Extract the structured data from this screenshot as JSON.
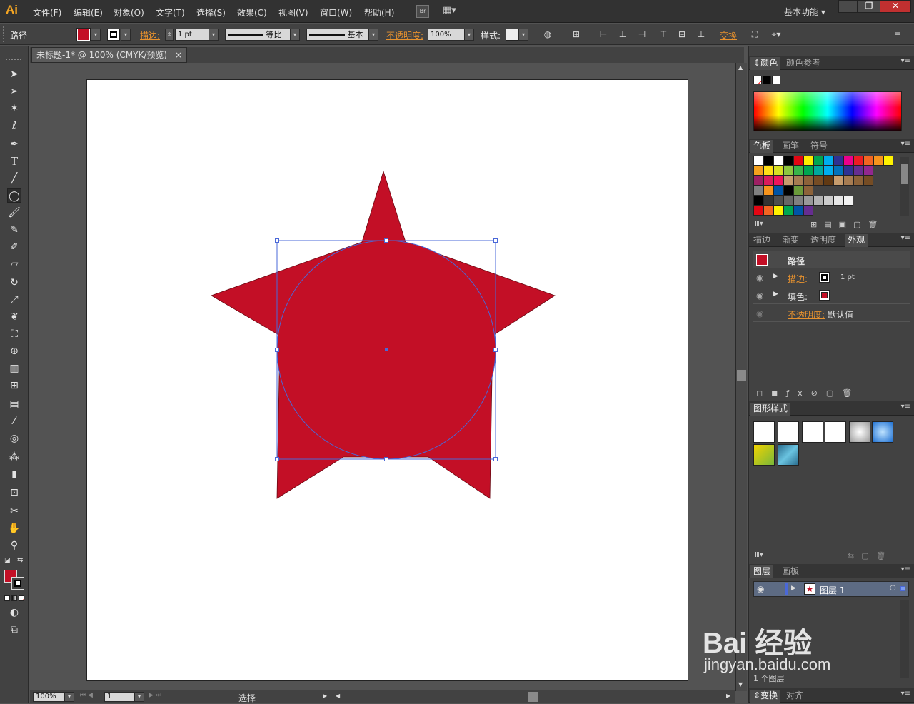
{
  "app": {
    "logo": "Ai",
    "workspace": "基本功能",
    "bridge": "Br"
  },
  "menu": [
    "文件(F)",
    "编辑(E)",
    "对象(O)",
    "文字(T)",
    "选择(S)",
    "效果(C)",
    "视图(V)",
    "窗口(W)",
    "帮助(H)"
  ],
  "control": {
    "object_type": "路径",
    "stroke_label": "描边:",
    "stroke_weight": "1 pt",
    "stroke_profile": "等比",
    "brush": "基本",
    "opacity_label": "不透明度:",
    "opacity": "100%",
    "style_label": "样式:",
    "transform": "变换"
  },
  "document": {
    "tab_title": "未标题-1* @ 100% (CMYK/预览)",
    "close": "×"
  },
  "status": {
    "zoom": "100%",
    "artboard": "1",
    "tool": "选择"
  },
  "panels": {
    "color": {
      "tabs": [
        "颜色",
        "颜色参考"
      ]
    },
    "swatches": {
      "tabs": [
        "色板",
        "画笔",
        "符号"
      ],
      "rows": [
        [
          "#ffffff",
          "#000000",
          "#ffffff",
          "#000000",
          "#e30613",
          "#ffed00",
          "#00a651",
          "#00aeef",
          "#2e3192",
          "#ec008c",
          "#ed1c24",
          "#f26522",
          "#f7941d",
          "#fff200"
        ],
        [
          "#f5a11c",
          "#ffde17",
          "#d7df23",
          "#8dc63f",
          "#39b54a",
          "#00a651",
          "#00a99d",
          "#00aeef",
          "#0072bc",
          "#2e3192",
          "#662d91",
          "#92278f"
        ],
        [
          "#9e1f63",
          "#d91b5c",
          "#ed145b",
          "#c69c6d",
          "#a67c52",
          "#8c6239",
          "#754c24",
          "#603913",
          "#c69c6d",
          "#a67c52",
          "#8c6239",
          "#754c24"
        ],
        [
          "#808080",
          "#f7941d",
          "#0054a6",
          "#000000",
          "#6a9a3a",
          "#8c6239"
        ],
        [
          "#000000",
          "#333333",
          "#4d4d4d",
          "#666666",
          "#808080",
          "#999999",
          "#b3b3b3",
          "#cccccc",
          "#e6e6e6",
          "#f2f2f2"
        ],
        [
          "#e30613",
          "#f26522",
          "#fff200",
          "#00a651",
          "#0054a6",
          "#662d91"
        ]
      ]
    },
    "appearance": {
      "tabs": [
        "描边",
        "渐变",
        "透明度",
        "外观"
      ],
      "title": "路径",
      "stroke_label": "描边:",
      "stroke_value": "1 pt",
      "fill_label": "填色:",
      "opacity_label": "不透明度:",
      "opacity_value": "默认值"
    },
    "graphic_styles": {
      "tabs": [
        "图形样式"
      ]
    },
    "layers": {
      "tabs": [
        "图层",
        "画板"
      ],
      "layer_name": "图层 1",
      "count": "1 个图层"
    },
    "bottom": {
      "tabs": [
        "变换",
        "对齐"
      ]
    }
  },
  "colors": {
    "fill": "#c30f26",
    "selection": "#4a68d8",
    "stroke": "#000000"
  },
  "watermark": {
    "brand": "Bai 经验",
    "url": "jingyan.baidu.com"
  }
}
